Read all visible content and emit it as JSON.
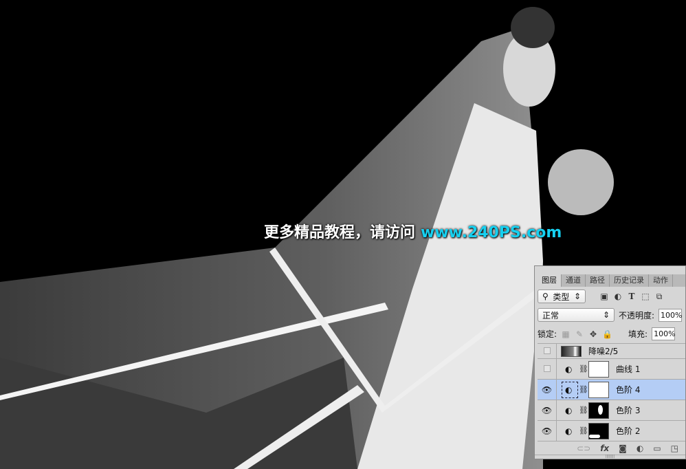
{
  "watermark": {
    "text": "更多精品教程，请访问",
    "url": "www.240PS.com",
    "url_color": "#16d0f0"
  },
  "layers_panel": {
    "tabs": [
      {
        "label": "图层",
        "active": true
      },
      {
        "label": "通道"
      },
      {
        "label": "路径"
      },
      {
        "label": "历史记录"
      },
      {
        "label": "动作"
      }
    ],
    "filter": {
      "label": "类型"
    },
    "blend_mode": "正常",
    "opacity": {
      "label": "不透明度:",
      "value": "100%"
    },
    "lock": {
      "label": "锁定:"
    },
    "fill": {
      "label": "填充:",
      "value": "100%"
    },
    "layers": [
      {
        "name": "降噪2/5",
        "visible": false
      },
      {
        "name": "曲线 1",
        "visible": false
      },
      {
        "name": "色阶 4",
        "visible": true,
        "selected": true
      },
      {
        "name": "色阶 3",
        "visible": true
      },
      {
        "name": "色阶 2",
        "visible": true
      }
    ]
  }
}
